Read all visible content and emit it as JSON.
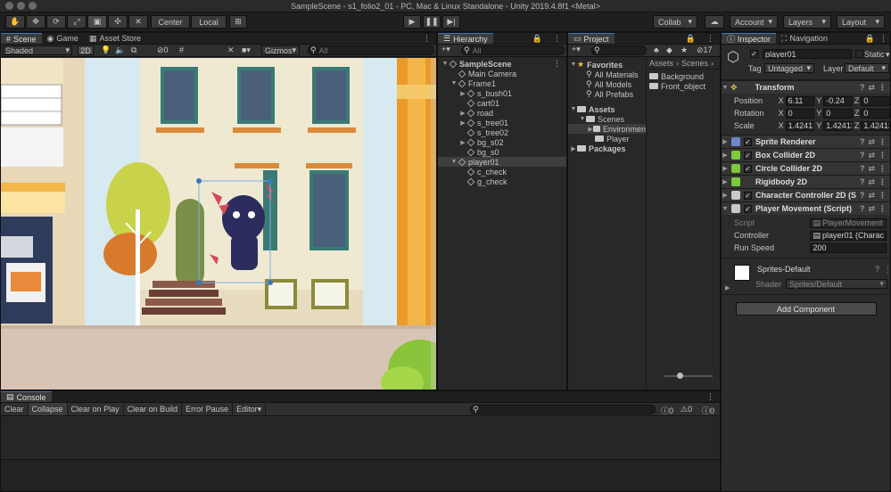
{
  "window": {
    "title": "SampleScene - s1_folio2_01 - PC, Mac & Linux Standalone - Unity 2019.4.8f1 <Metal>"
  },
  "toolbar": {
    "center_label": "Center",
    "local_label": "Local",
    "collab_label": "Collab",
    "account_label": "Account",
    "layers_label": "Layers",
    "layout_label": "Layout"
  },
  "scene_panel": {
    "tabs": [
      "Scene",
      "Game",
      "Asset Store"
    ],
    "shading_mode": "Shaded",
    "mode_2d": "2D",
    "gizmos_label": "Gizmos",
    "search_placeholder": "All",
    "audio_count": "0"
  },
  "hierarchy": {
    "tab": "Hierarchy",
    "search_placeholder": "All",
    "items": [
      {
        "label": "SampleScene",
        "depth": 0,
        "expanded": true,
        "bold": true
      },
      {
        "label": "Main Camera",
        "depth": 1
      },
      {
        "label": "Frame1",
        "depth": 1,
        "expanded": true
      },
      {
        "label": "s_bush01",
        "depth": 2,
        "collapsed": true
      },
      {
        "label": "cart01",
        "depth": 2
      },
      {
        "label": "road",
        "depth": 2,
        "collapsed": true
      },
      {
        "label": "s_tree01",
        "depth": 2,
        "collapsed": true
      },
      {
        "label": "s_tree02",
        "depth": 2
      },
      {
        "label": "bg_s02",
        "depth": 2,
        "collapsed": true
      },
      {
        "label": "bg_s0",
        "depth": 2
      },
      {
        "label": "player01",
        "depth": 1,
        "expanded": true,
        "selected": true
      },
      {
        "label": "c_check",
        "depth": 2
      },
      {
        "label": "g_check",
        "depth": 2
      }
    ]
  },
  "project": {
    "tab": "Project",
    "filter_count": "17",
    "breadcrumb": [
      "Assets",
      "Scenes"
    ],
    "favorites": {
      "label": "Favorites",
      "items": [
        "All Materials",
        "All Models",
        "All Prefabs"
      ]
    },
    "assets": {
      "label": "Assets",
      "scenes_label": "Scenes",
      "children": [
        "Environmen",
        "Player"
      ],
      "packages_label": "Packages"
    },
    "folder_contents": [
      "Background",
      "Front_object"
    ]
  },
  "inspector": {
    "tabs": [
      "Inspector",
      "Navigation"
    ],
    "object_name": "player01",
    "static_label": "Static",
    "tag_label": "Tag",
    "tag_value": "Untagged",
    "layer_label": "Layer",
    "layer_value": "Default",
    "transform": {
      "title": "Transform",
      "position_label": "Position",
      "position": {
        "x": "6.11",
        "y": "-0.24",
        "z": "0"
      },
      "rotation_label": "Rotation",
      "rotation": {
        "x": "0",
        "y": "0",
        "z": "0"
      },
      "scale_label": "Scale",
      "scale": {
        "x": "1.42413",
        "y": "1.42413",
        "z": "1.42413"
      }
    },
    "components": [
      {
        "name": "Sprite Renderer",
        "color": "#6d87c9",
        "checked": true
      },
      {
        "name": "Box Collider 2D",
        "color": "#7cc93a",
        "checked": true
      },
      {
        "name": "Circle Collider 2D",
        "color": "#7cc93a",
        "checked": true
      },
      {
        "name": "Rigidbody 2D",
        "color": "#7cc93a",
        "checked": false
      },
      {
        "name": "Character Controller 2D (S",
        "color": "#c9c9c9",
        "checked": true
      },
      {
        "name": "Player Movement (Script)",
        "color": "#c9c9c9",
        "checked": true
      }
    ],
    "script": {
      "script_label": "Script",
      "script_value": "PlayerMovement",
      "controller_label": "Controller",
      "controller_value": "player01 (Charac",
      "speed_label": "Run Speed",
      "speed_value": "200"
    },
    "material": {
      "name": "Sprites-Default",
      "shader_label": "Shader",
      "shader_value": "Sprites/Default"
    },
    "add_component_label": "Add Component"
  },
  "console": {
    "tab": "Console",
    "buttons": [
      "Clear",
      "Collapse",
      "Clear on Play",
      "Clear on Build",
      "Error Pause",
      "Editor"
    ],
    "counts": {
      "log": "0",
      "warn": "0",
      "error": "0"
    }
  },
  "colors": {
    "accent": "#3a79bb",
    "selection": "#2c5d87"
  }
}
